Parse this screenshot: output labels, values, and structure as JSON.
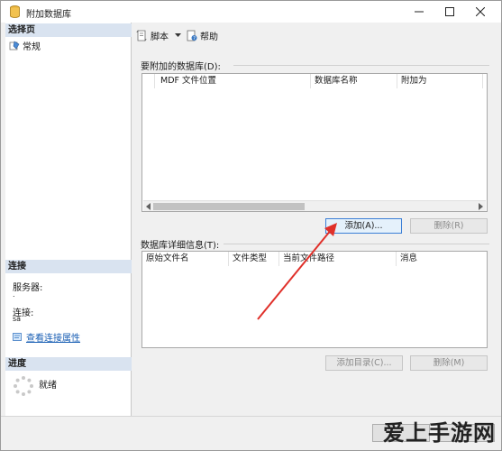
{
  "window": {
    "title": "附加数据库",
    "min_label": "—",
    "max_label": "☐",
    "close_label": "✕"
  },
  "sidebar": {
    "select_page_header": "选择页",
    "pages": [
      {
        "label": "常规"
      }
    ],
    "connection_header": "连接",
    "server_label": "服务器:",
    "server_value": ".",
    "connection_label": "连接:",
    "connection_value": "sa",
    "view_connection_link": "查看连接属性",
    "progress_header": "进度",
    "progress_status": "就绪"
  },
  "toolbar": {
    "script_label": "脚本",
    "help_label": "帮助"
  },
  "attach_group": {
    "label": "要附加的数据库(D):",
    "columns": [
      "MDF 文件位置",
      "数据库名称",
      "附加为"
    ],
    "rows": [],
    "add_button": "添加(A)...",
    "remove_button": "删除(R)"
  },
  "details_group": {
    "label": "数据库详细信息(T):",
    "columns": [
      "原始文件名",
      "文件类型",
      "当前文件路径",
      "消息"
    ],
    "rows": [],
    "add_catalog_button": "添加目录(C)...",
    "remove_button": "删除(M)"
  },
  "watermark": "爱上手游网",
  "colors": {
    "section_header_bg": "#d9e3f0",
    "link": "#1a5fb4",
    "arrow": "#e0302a",
    "primary_border": "#3c7fd6"
  }
}
